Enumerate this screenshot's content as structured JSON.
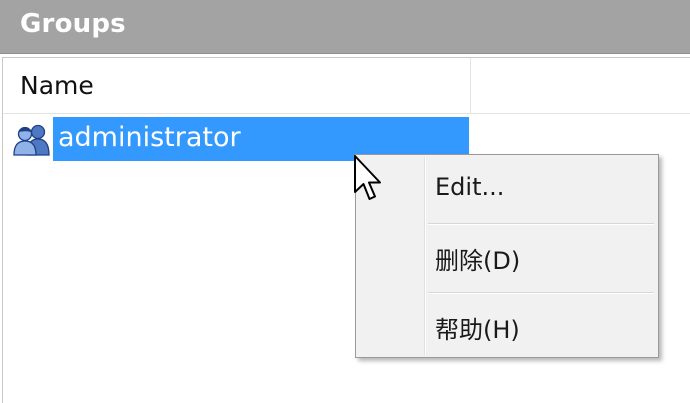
{
  "panel": {
    "title": "Groups"
  },
  "list": {
    "columns": [
      {
        "label": "Name"
      }
    ],
    "rows": [
      {
        "label": "administrator",
        "icon": "group-icon",
        "selected": true
      }
    ]
  },
  "context_menu": {
    "items": [
      {
        "label": "Edit..."
      },
      {
        "label": "删除(D)"
      },
      {
        "label": "帮助(H)"
      }
    ]
  },
  "colors": {
    "header_bg": "#a3a3a3",
    "selection": "#3399ff",
    "menu_bg": "#f1f1f1"
  },
  "icons": {
    "cursor": "mouse-pointer-icon"
  }
}
